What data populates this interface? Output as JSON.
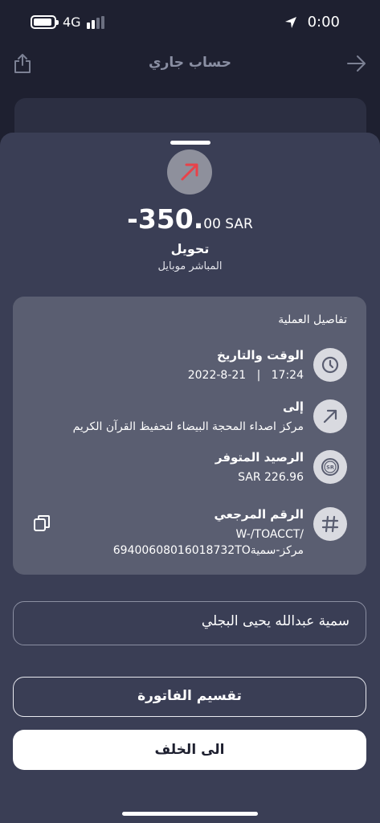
{
  "status_bar": {
    "network": "4G",
    "time": "0:00"
  },
  "background_screen": {
    "title": "حساب جاري"
  },
  "transaction": {
    "amount_main": "-350.",
    "amount_fraction": "00 SAR",
    "type": "تحويل",
    "channel": "المباشر موبايل",
    "direction_icon": "outgoing-arrow-icon",
    "accent": "#e8424a"
  },
  "details": {
    "title": "تفاصيل العملية",
    "datetime": {
      "label": "الوقت والتاريخ",
      "time": "17:24",
      "separator": "|",
      "date": "2022-8-21"
    },
    "to": {
      "label": "إلى",
      "value": "مركز اصداء المحجة البيضاء لتحفيظ القرآن الكريم"
    },
    "balance": {
      "label": "الرصيد المتوفر",
      "value": "SAR 226.96"
    },
    "reference": {
      "label": "الرقم المرجعي",
      "line1": "W-/TOACCT/",
      "line2": "69400608016018732TOمركز-سمية"
    }
  },
  "name_field": {
    "value": "سمية عبدالله يحيى البجلي"
  },
  "buttons": {
    "split_bill": "تقسيم الفاتورة",
    "back": "الى الخلف"
  }
}
